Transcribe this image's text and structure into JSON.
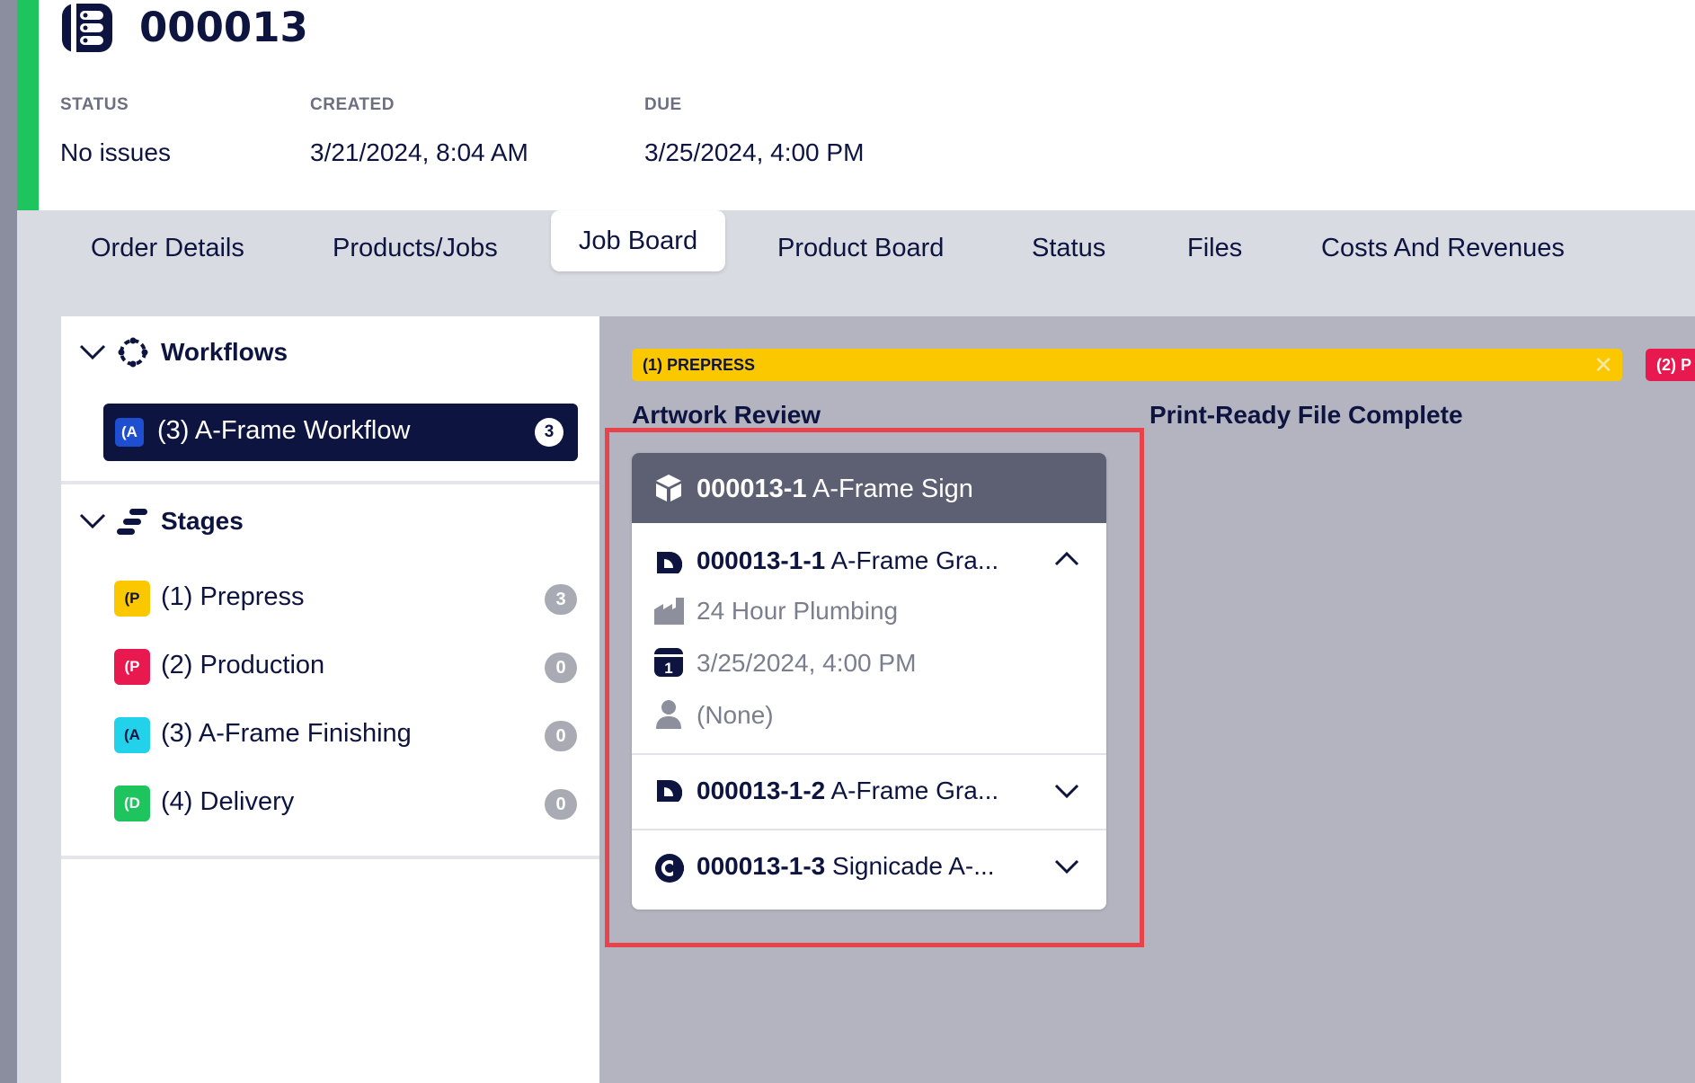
{
  "order": {
    "number": "000013",
    "status_label": "STATUS",
    "status_value": "No issues",
    "created_label": "CREATED",
    "created_value": "3/21/2024, 8:04 AM",
    "due_label": "DUE",
    "due_value": "3/25/2024, 4:00 PM"
  },
  "tabs": [
    {
      "label": "Order Details"
    },
    {
      "label": "Products/Jobs"
    },
    {
      "label": "Job Board"
    },
    {
      "label": "Product Board"
    },
    {
      "label": "Status"
    },
    {
      "label": "Files"
    },
    {
      "label": "Costs And Revenues"
    }
  ],
  "active_tab": "Job Board",
  "sidebar": {
    "workflows_title": "Workflows",
    "workflow": {
      "badge": "(A",
      "label": "(3) A-Frame Workflow",
      "count": "3"
    },
    "stages_title": "Stages",
    "stages": [
      {
        "badge": "(P",
        "label": "(1) Prepress",
        "count": "3",
        "color": "#fbc800",
        "text_color": "#0e1440"
      },
      {
        "badge": "(P",
        "label": "(2) Production",
        "count": "0",
        "color": "#e8194e",
        "text_color": "#ffffff"
      },
      {
        "badge": "(A",
        "label": "(3) A-Frame Finishing",
        "count": "0",
        "color": "#21d2ea",
        "text_color": "#0e1440"
      },
      {
        "badge": "(D",
        "label": "(4) Delivery",
        "count": "0",
        "color": "#1ec45e",
        "text_color": "#ffffff"
      }
    ]
  },
  "board": {
    "stage1_label": "(1) PREPRESS",
    "stage2_label": "(2) P",
    "columns": [
      "Artwork Review",
      "Print-Ready File Complete"
    ],
    "card": {
      "product_id": "000013-1",
      "product_name": "A-Frame Sign",
      "jobs": [
        {
          "id": "000013-1-1",
          "name": "A-Frame Gra...",
          "expanded": true,
          "customer": "24 Hour Plumbing",
          "due": "3/25/2024, 4:00 PM",
          "assignee": "(None)"
        },
        {
          "id": "000013-1-2",
          "name": "A-Frame Gra...",
          "expanded": false
        },
        {
          "id": "000013-1-3",
          "name": "Signicade A-...",
          "expanded": false
        }
      ]
    }
  },
  "colors": {
    "navy": "#0e1440",
    "green_bar": "#1ec45e",
    "highlight": "#e8424a",
    "prepress": "#fbc800",
    "production": "#e8194e"
  }
}
